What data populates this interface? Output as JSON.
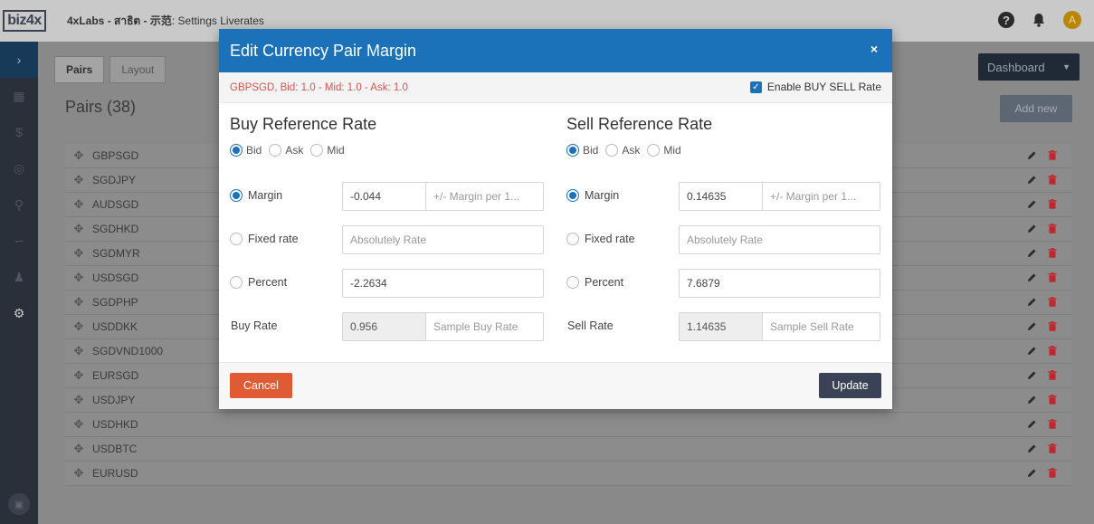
{
  "header": {
    "logo": "biz4x",
    "title_bold": "4xLabs - สาธิต - 示范",
    "title_rest": ": Settings Liverates",
    "help_icon": "question-circle-icon",
    "bell_icon": "bell-icon",
    "avatar_letter": "A"
  },
  "colors": {
    "modal_header": "#1c72b8",
    "cancel": "#e05b34",
    "update": "#3a4355",
    "pair_info": "#d9534f",
    "trash": "#c0262d"
  },
  "main": {
    "tabs": [
      {
        "label": "Pairs",
        "active": true
      },
      {
        "label": "Layout",
        "active": false
      }
    ],
    "dashboard_label": "Dashboard",
    "heading": "Pairs (38)",
    "add_new_label": "Add new",
    "pairs": [
      "GBPSGD",
      "SGDJPY",
      "AUDSGD",
      "SGDHKD",
      "SGDMYR",
      "USDSGD",
      "SGDPHP",
      "USDDKK",
      "SGDVND1000",
      "EURSGD",
      "USDJPY",
      "USDHKD",
      "USDBTC",
      "EURUSD"
    ]
  },
  "modal": {
    "title": "Edit Currency Pair Margin",
    "close": "×",
    "pair_info": "GBPSGD, Bid: 1.0 - Mid: 1.0 - Ask: 1.0",
    "enable_label": "Enable BUY SELL Rate",
    "enable_checked": true,
    "buy": {
      "title": "Buy Reference Rate",
      "ref_options": {
        "bid": "Bid",
        "ask": "Ask",
        "mid": "Mid"
      },
      "selected_ref": "Bid",
      "margin_label": "Margin",
      "margin_value": "-0.044",
      "margin_placeholder": "+/- Margin per 1...",
      "fixed_label": "Fixed rate",
      "fixed_placeholder": "Absolutely Rate",
      "percent_label": "Percent",
      "percent_value": "-2.2634",
      "rate_label": "Buy Rate",
      "rate_value": "0.956",
      "rate_placeholder": "Sample Buy Rate"
    },
    "sell": {
      "title": "Sell Reference Rate",
      "ref_options": {
        "bid": "Bid",
        "ask": "Ask",
        "mid": "Mid"
      },
      "selected_ref": "Bid",
      "margin_label": "Margin",
      "margin_value": "0.14635",
      "margin_placeholder": "+/- Margin per 1...",
      "fixed_label": "Fixed rate",
      "fixed_placeholder": "Absolutely Rate",
      "percent_label": "Percent",
      "percent_value": "7.6879",
      "rate_label": "Sell Rate",
      "rate_value": "1.14635",
      "rate_placeholder": "Sample Sell Rate"
    },
    "cancel_label": "Cancel",
    "update_label": "Update"
  }
}
